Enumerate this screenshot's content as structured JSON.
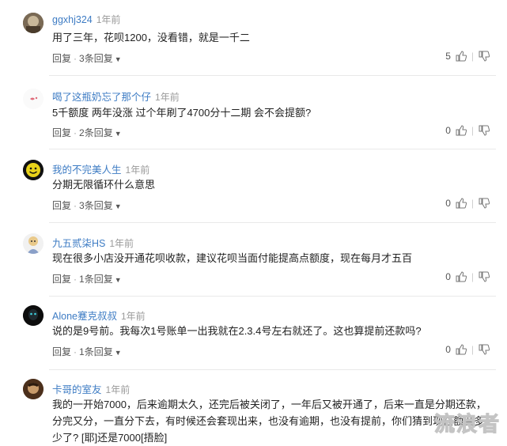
{
  "comments": [
    {
      "user": "ggxhj324",
      "time": "1年前",
      "text": "用了三年，花呗1200，没看错，就是一千二",
      "reply": "回复",
      "replies": "3条回复",
      "likes": "5"
    },
    {
      "user": "喝了这瓶奶忘了那个仔",
      "time": "1年前",
      "text": "5千额度 两年没涨 过个年刷了4700分十二期 会不会提额?",
      "reply": "回复",
      "replies": "2条回复",
      "likes": "0"
    },
    {
      "user": "我的不完美人生",
      "time": "1年前",
      "text": "分期无限循环什么意思",
      "reply": "回复",
      "replies": "3条回复",
      "likes": "0"
    },
    {
      "user": "九五贰柒HS",
      "time": "1年前",
      "text": "现在很多小店没开通花呗收款，建议花呗当面付能提高点额度，现在每月才五百",
      "reply": "回复",
      "replies": "1条回复",
      "likes": "0"
    },
    {
      "user": "Alone蹇克叔叔",
      "time": "1年前",
      "text": "说的是9号前。我每次1号账单一出我就在2.3.4号左右就还了。这也算提前还款吗?",
      "reply": "回复",
      "replies": "1条回复",
      "likes": "0"
    },
    {
      "user": "卡哥的室友",
      "time": "1年前",
      "text": "我的一开始7000，后来逾期太久，还完后被关闭了，一年后又被开通了，后来一直是分期还款，分完又分，一直分下去，有时候还会套现出来，也没有逾期，也没有提前，你们猜到现在额度多少了? [耶]还是7000[捂脸]"
    }
  ],
  "watermark": "流浪者"
}
